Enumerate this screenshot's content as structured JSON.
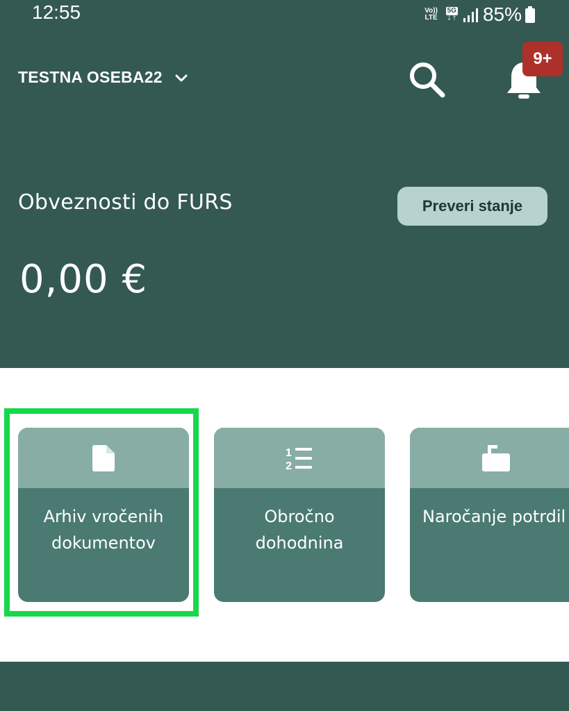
{
  "status_bar": {
    "time": "12:55",
    "volte_line1": "Vo))",
    "volte_line2": "LTE",
    "network": "5G",
    "battery": "85%"
  },
  "header": {
    "account_name": "TESTNA OSEBA22",
    "notification_badge": "9+",
    "obligations_label": "Obveznosti do FURS",
    "check_button": "Preveri stanje",
    "amount": "0,00 €"
  },
  "tiles": [
    {
      "label": "Arhiv vročenih\ndokumentov",
      "icon": "document-icon"
    },
    {
      "label": "Obročno\ndohodnina",
      "icon": "numbered-list-icon"
    },
    {
      "label": "Naročanje potrdil",
      "icon": "mailbox-icon"
    }
  ],
  "colors": {
    "header_bg": "#345953",
    "tile_top": "#88ada5",
    "tile_body": "#4a7a72",
    "highlight": "#16d84a",
    "badge": "#ae302a",
    "button_bg": "#b7d3cf"
  }
}
